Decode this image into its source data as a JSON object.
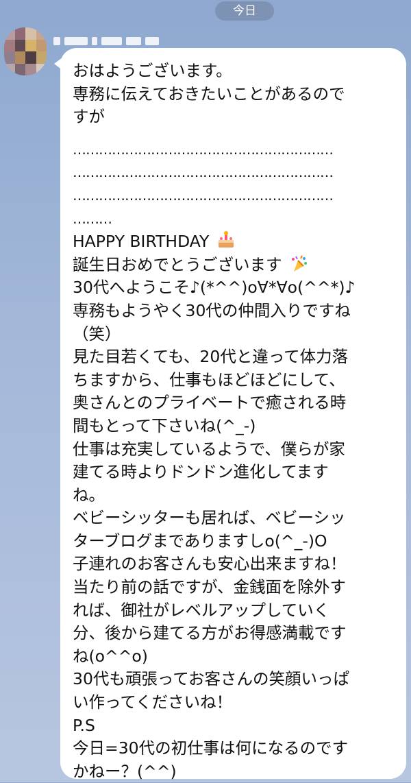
{
  "header": {
    "date_label": "今日"
  },
  "sender": {
    "avatar": "blurred-avatar",
    "name": ""
  },
  "message": {
    "lines": [
      "おはようございます。",
      "専務に伝えておきたいことがあるので",
      "すが",
      "",
      "……………………………………………………",
      "……………………………………………………",
      "……………………………………………………",
      "………",
      "HAPPY  BIRTHDAY",
      "誕生日おめでとうございます",
      "30代へようこそ♪(*^^)o∀*∀o(^^*)♪",
      "専務もようやく30代の仲間入りですね",
      "（笑）",
      "見た目若くても、20代と違って体力落",
      "ちますから、仕事もほどほどにして、",
      "奥さんとのプライベートで癒される時",
      "間もとって下さいね(^_-)",
      "仕事は充実しているようで、僕らが家",
      "建てる時よりドンドン進化してます",
      "ね。",
      "ベビーシッターも居れば、ベビーシッ",
      "ターブログまでありますしo(^_-)O",
      "子連れのお客さんも安心出来ますね！",
      "当たり前の話ですが、金銭面を除外す",
      "れば、御社がレベルアップしていく",
      "分、後から建てる方がお得感満載です",
      "ね(o^^o)",
      "30代も頑張ってお客さんの笑顔いっぱ",
      "い作ってくださいね！",
      "P.S",
      "今日=30代の初仕事は何になるのです",
      "かねー？(^^)"
    ],
    "emoji": {
      "birthday": "birthday-cake-icon",
      "celebrate": "party-popper-icon"
    }
  },
  "colors": {
    "background_top": "#8ea8cf",
    "background_bottom": "#b7c6e0",
    "bubble": "#ffffff",
    "text": "#111111",
    "date_chip": "#7a8caa"
  }
}
